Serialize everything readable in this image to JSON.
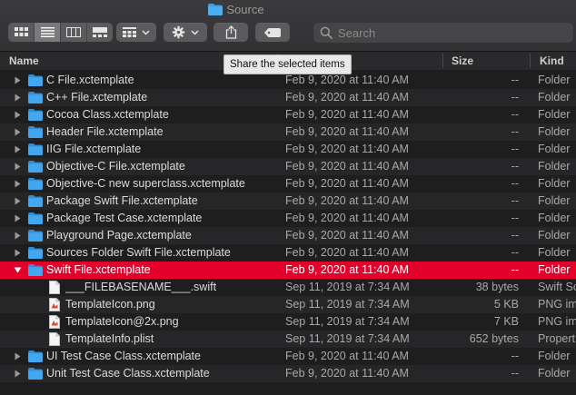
{
  "window": {
    "title": "Source"
  },
  "toolbar": {
    "tooltip": "Share the selected items"
  },
  "search": {
    "placeholder": "Search"
  },
  "columns": {
    "name": "Name",
    "date": "",
    "size": "Size",
    "kind": "Kind"
  },
  "rows": [
    {
      "name": "C File.xctemplate",
      "date": "Feb 9, 2020 at 11:40 AM",
      "size": "--",
      "kind": "Folder",
      "type": "folder",
      "level": 0,
      "disclosure": "collapsed"
    },
    {
      "name": "C++ File.xctemplate",
      "date": "Feb 9, 2020 at 11:40 AM",
      "size": "--",
      "kind": "Folder",
      "type": "folder",
      "level": 0,
      "disclosure": "collapsed"
    },
    {
      "name": "Cocoa Class.xctemplate",
      "date": "Feb 9, 2020 at 11:40 AM",
      "size": "--",
      "kind": "Folder",
      "type": "folder",
      "level": 0,
      "disclosure": "collapsed"
    },
    {
      "name": "Header File.xctemplate",
      "date": "Feb 9, 2020 at 11:40 AM",
      "size": "--",
      "kind": "Folder",
      "type": "folder",
      "level": 0,
      "disclosure": "collapsed"
    },
    {
      "name": "IIG File.xctemplate",
      "date": "Feb 9, 2020 at 11:40 AM",
      "size": "--",
      "kind": "Folder",
      "type": "folder",
      "level": 0,
      "disclosure": "collapsed"
    },
    {
      "name": "Objective-C File.xctemplate",
      "date": "Feb 9, 2020 at 11:40 AM",
      "size": "--",
      "kind": "Folder",
      "type": "folder",
      "level": 0,
      "disclosure": "collapsed"
    },
    {
      "name": "Objective-C new superclass.xctemplate",
      "date": "Feb 9, 2020 at 11:40 AM",
      "size": "--",
      "kind": "Folder",
      "type": "folder",
      "level": 0,
      "disclosure": "collapsed"
    },
    {
      "name": "Package Swift File.xctemplate",
      "date": "Feb 9, 2020 at 11:40 AM",
      "size": "--",
      "kind": "Folder",
      "type": "folder",
      "level": 0,
      "disclosure": "collapsed"
    },
    {
      "name": "Package Test Case.xctemplate",
      "date": "Feb 9, 2020 at 11:40 AM",
      "size": "--",
      "kind": "Folder",
      "type": "folder",
      "level": 0,
      "disclosure": "collapsed"
    },
    {
      "name": "Playground Page.xctemplate",
      "date": "Feb 9, 2020 at 11:40 AM",
      "size": "--",
      "kind": "Folder",
      "type": "folder",
      "level": 0,
      "disclosure": "collapsed"
    },
    {
      "name": "Sources Folder Swift File.xctemplate",
      "date": "Feb 9, 2020 at 11:40 AM",
      "size": "--",
      "kind": "Folder",
      "type": "folder",
      "level": 0,
      "disclosure": "collapsed"
    },
    {
      "name": "Swift File.xctemplate",
      "date": "Feb 9, 2020 at 11:40 AM",
      "size": "--",
      "kind": "Folder",
      "type": "folder",
      "level": 0,
      "disclosure": "expanded",
      "selected": true
    },
    {
      "name": "___FILEBASENAME___.swift",
      "date": "Sep 11, 2019 at 7:34 AM",
      "size": "38 bytes",
      "kind": "Swift Sc",
      "type": "doc",
      "level": 1
    },
    {
      "name": "TemplateIcon.png",
      "date": "Sep 11, 2019 at 7:34 AM",
      "size": "5 KB",
      "kind": "PNG im",
      "type": "image",
      "level": 1
    },
    {
      "name": "TemplateIcon@2x.png",
      "date": "Sep 11, 2019 at 7:34 AM",
      "size": "7 KB",
      "kind": "PNG im",
      "type": "image",
      "level": 1
    },
    {
      "name": "TemplateInfo.plist",
      "date": "Sep 11, 2019 at 7:34 AM",
      "size": "652 bytes",
      "kind": "Propert",
      "type": "doc",
      "level": 1
    },
    {
      "name": "UI Test Case Class.xctemplate",
      "date": "Feb 9, 2020 at 11:40 AM",
      "size": "--",
      "kind": "Folder",
      "type": "folder",
      "level": 0,
      "disclosure": "collapsed"
    },
    {
      "name": "Unit Test Case Class.xctemplate",
      "date": "Feb 9, 2020 at 11:40 AM",
      "size": "--",
      "kind": "Folder",
      "type": "folder",
      "level": 0,
      "disclosure": "collapsed"
    }
  ],
  "colors": {
    "selection": "#e3002b",
    "folder": "#3d9ee6",
    "background": "#1e1e1e"
  }
}
